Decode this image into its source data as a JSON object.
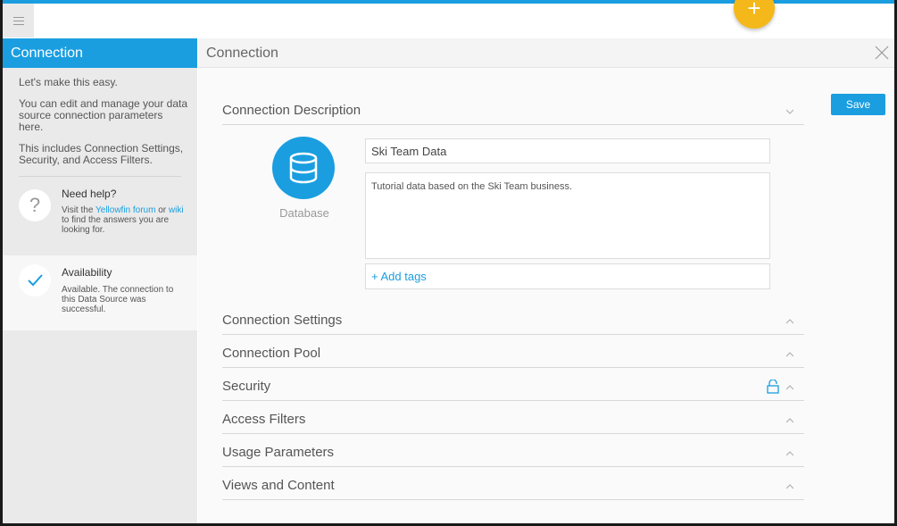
{
  "app": {
    "fab_symbol": "+",
    "accent": "#1a9ee0",
    "fab_color": "#f5b81a"
  },
  "sidebar": {
    "title": "Connection",
    "intro": [
      "Let's make this easy.",
      "You can edit and manage your data source connection parameters here.",
      "This includes Connection Settings, Security, and Access Filters."
    ],
    "help": {
      "title": "Need help?",
      "icon": "question-icon",
      "text_before": "Visit the ",
      "link1": "Yellowfin forum",
      "text_mid": " or ",
      "link2": "wiki",
      "text_after": " to find the answers you are looking for."
    },
    "availability": {
      "title": "Availability",
      "icon": "check-icon",
      "text": "Available. The connection to this Data Source was successful."
    }
  },
  "main": {
    "title": "Connection",
    "save_label": "Save",
    "description_section": "Connection Description",
    "db_label": "Database",
    "name_value": "Ski Team Data",
    "description_value": "Tutorial data based on the Ski Team business.",
    "add_tags": "+ Add tags",
    "sections": [
      "Connection Settings",
      "Connection Pool",
      "Security",
      "Access Filters",
      "Usage Parameters",
      "Views and Content"
    ]
  }
}
